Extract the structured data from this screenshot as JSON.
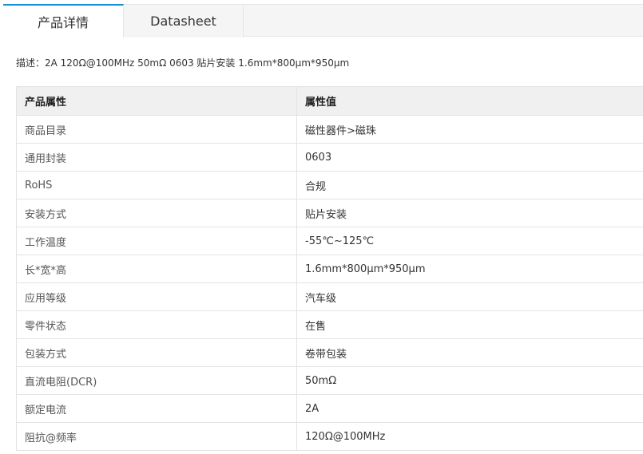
{
  "tabs": [
    {
      "label": "产品详情",
      "active": true
    },
    {
      "label": "Datasheet",
      "active": false
    }
  ],
  "description": "描述：2A 120Ω@100MHz 50mΩ 0603 贴片安装 1.6mm*800μm*950μm",
  "table": {
    "headers": [
      "产品属性",
      "属性值"
    ],
    "rows": [
      {
        "key": "商品目录",
        "value": "磁性器件>磁珠"
      },
      {
        "key": "通用封装",
        "value": "0603"
      },
      {
        "key": "RoHS",
        "value": "合规"
      },
      {
        "key": "安装方式",
        "value": "贴片安装"
      },
      {
        "key": "工作温度",
        "value": "-55℃~125℃"
      },
      {
        "key": "长*宽*高",
        "value": "1.6mm*800μm*950μm"
      },
      {
        "key": "应用等级",
        "value": "汽车级"
      },
      {
        "key": "零件状态",
        "value": "在售"
      },
      {
        "key": "包装方式",
        "value": "卷带包装"
      },
      {
        "key": "直流电阻(DCR)",
        "value": "50mΩ"
      },
      {
        "key": "额定电流",
        "value": "2A"
      },
      {
        "key": "阻抗@频率",
        "value": "120Ω@100MHz"
      }
    ]
  },
  "colors": {
    "accent": "#1a8fd6",
    "tab_bg": "#f5f5f5",
    "header_bg": "#f0f0f0",
    "border": "#e3e3e3"
  }
}
